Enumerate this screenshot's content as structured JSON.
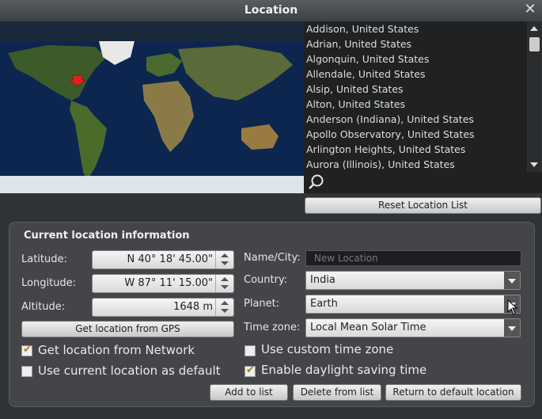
{
  "window": {
    "title": "Location",
    "close_glyph": "✕"
  },
  "cities": [
    "Addison, United States",
    "Adrian, United States",
    "Algonquin, United States",
    "Allendale, United States",
    "Alsip, United States",
    "Alton, United States",
    "Anderson (Indiana), United States",
    "Apollo Observatory, United States",
    "Arlington Heights, United States",
    "Aurora (Illinois), United States"
  ],
  "search_icon": "magnifier-icon",
  "reset_label": "Reset Location List",
  "info": {
    "title": "Current location information",
    "latitude_label": "Latitude:",
    "latitude_value": "N 40° 18' 45.00\"",
    "longitude_label": "Longitude:",
    "longitude_value": "W 87° 11' 15.00\"",
    "altitude_label": "Altitude:",
    "altitude_value": "1648 m",
    "gps_button": "Get location from GPS",
    "network_label": "Get location from Network",
    "network_checked": true,
    "default_label": "Use current location as default",
    "default_checked": false,
    "name_label": "Name/City:",
    "name_placeholder": "New Location",
    "country_label": "Country:",
    "country_value": "India",
    "planet_label": "Planet:",
    "planet_value": "Earth",
    "timezone_label": "Time zone:",
    "timezone_value": "Local Mean Solar Time",
    "custom_tz_label": "Use custom time zone",
    "custom_tz_checked": false,
    "dst_label": "Enable daylight saving time",
    "dst_checked": true,
    "add_button": "Add to list",
    "delete_button": "Delete from list",
    "return_button": "Return to default location"
  },
  "colors": {
    "check_mark": "#b07a0c",
    "marker": "#e02020",
    "panel": "#46494c"
  }
}
